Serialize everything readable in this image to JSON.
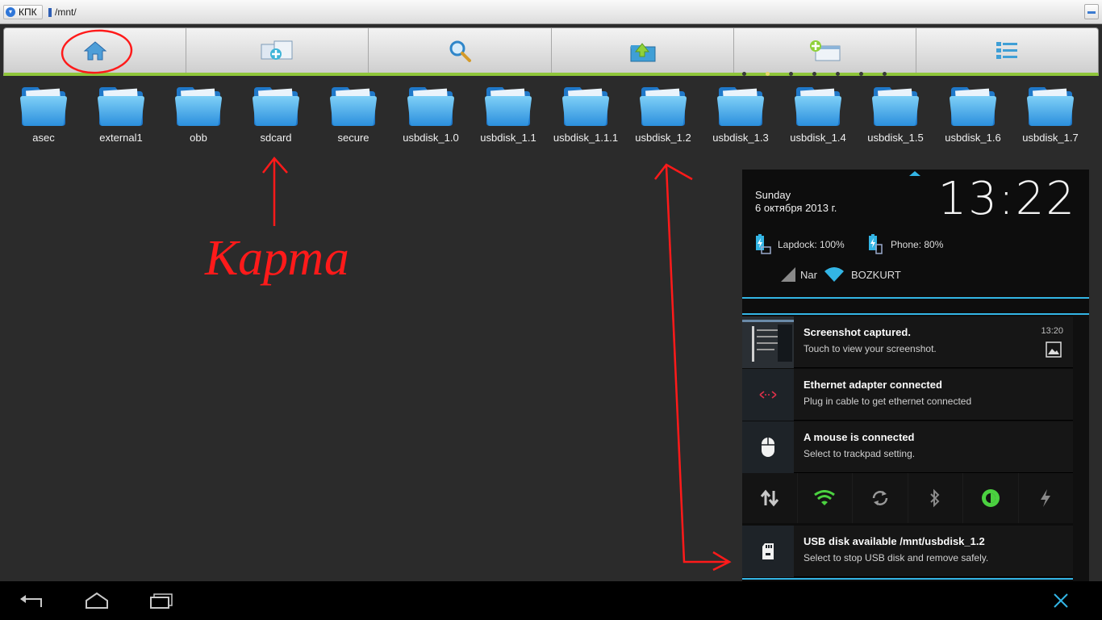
{
  "titlebar": {
    "app_label": "КПК",
    "path": "/mnt/"
  },
  "toolbar": {
    "buttons": [
      {
        "name": "home-icon"
      },
      {
        "name": "new-folder-icon"
      },
      {
        "name": "search-icon"
      },
      {
        "name": "folder-up-icon"
      },
      {
        "name": "add-window-icon"
      },
      {
        "name": "list-view-icon"
      }
    ],
    "accent": "#8fc63a"
  },
  "folders": [
    "asec",
    "external1",
    "obb",
    "sdcard",
    "secure",
    "usbdisk_1.0",
    "usbdisk_1.1",
    "usbdisk_1.1.1",
    "usbdisk_1.2",
    "usbdisk_1.3",
    "usbdisk_1.4",
    "usbdisk_1.5",
    "usbdisk_1.6",
    "usbdisk_1.7"
  ],
  "annotation": {
    "label": "Карта",
    "color": "#ff1a1a"
  },
  "notifications_panel": {
    "day": "Sunday",
    "date": "6 октября 2013 г.",
    "clock": "13:22",
    "battery_laptop": "Lapdock: 100%",
    "battery_phone": "Phone: 80%",
    "carrier": "Nar",
    "wifi_name": "BOZKURT",
    "items": [
      {
        "title": "Screenshot captured.",
        "text": "Touch to view your screenshot.",
        "time": "13:20"
      },
      {
        "title": "Ethernet adapter connected",
        "text": "Plug in cable to get ethernet connected"
      },
      {
        "title": "A mouse is connected",
        "text": "Select to trackpad setting."
      },
      {
        "title": "USB disk available /mnt/usbdisk_1.2",
        "text": "Select to stop USB disk and remove safely."
      }
    ],
    "quick_settings": [
      "data-toggle-icon",
      "wifi-icon",
      "sync-icon",
      "bluetooth-icon",
      "brightness-icon",
      "power-save-icon"
    ],
    "accent": "#33b5e5"
  },
  "navbar": {
    "buttons": [
      "back-icon",
      "home-icon",
      "recent-apps-icon",
      "close-icon"
    ]
  }
}
